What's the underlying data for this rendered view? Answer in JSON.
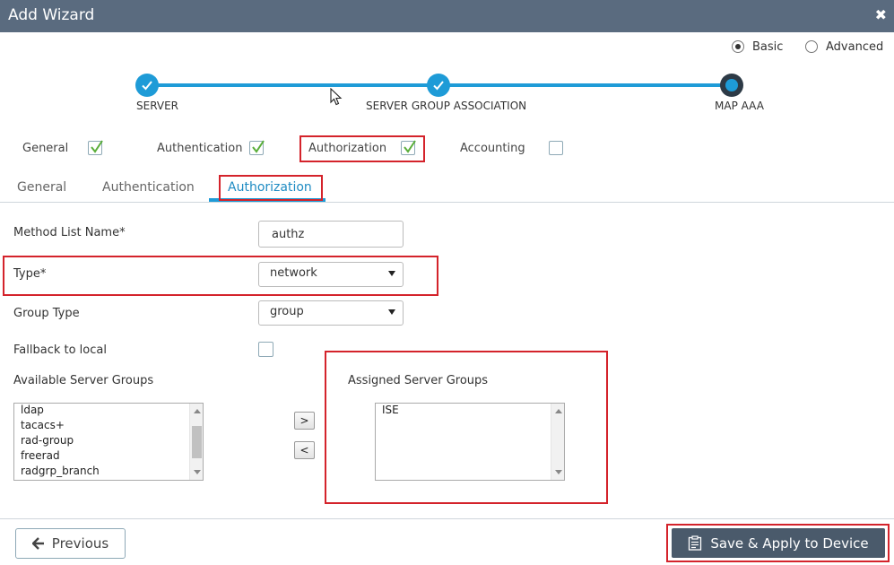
{
  "window": {
    "title": "Add Wizard",
    "close_glyph": "✖"
  },
  "mode": {
    "basic": "Basic",
    "advanced": "Advanced",
    "selected": "Basic"
  },
  "steps": [
    {
      "label": "SERVER",
      "state": "done"
    },
    {
      "label": "SERVER GROUP ASSOCIATION",
      "state": "done"
    },
    {
      "label": "MAP AAA",
      "state": "current"
    }
  ],
  "features": [
    {
      "label": "General",
      "checked": true
    },
    {
      "label": "Authentication",
      "checked": true
    },
    {
      "label": "Authorization",
      "checked": true
    },
    {
      "label": "Accounting",
      "checked": false
    }
  ],
  "tabs": [
    {
      "label": "General"
    },
    {
      "label": "Authentication"
    },
    {
      "label": "Authorization",
      "active": true
    }
  ],
  "form": {
    "method_list_label": "Method List Name*",
    "method_list_value": "authz",
    "type_label": "Type*",
    "type_value": "network",
    "group_type_label": "Group Type",
    "group_type_value": "group",
    "fallback_label": "Fallback to local",
    "fallback_checked": false
  },
  "available": {
    "label": "Available Server Groups",
    "items": [
      "ldap",
      "tacacs+",
      "rad-group",
      "freerad",
      "radgrp_branch"
    ]
  },
  "assigned": {
    "label": "Assigned Server Groups",
    "items": [
      "ISE"
    ]
  },
  "move": {
    "right": ">",
    "left": "<"
  },
  "footer": {
    "previous": "Previous",
    "save": "Save & Apply to Device"
  },
  "colors": {
    "accent": "#1e9bd7",
    "highlight": "#d4232b",
    "header": "#5a6b7f"
  }
}
